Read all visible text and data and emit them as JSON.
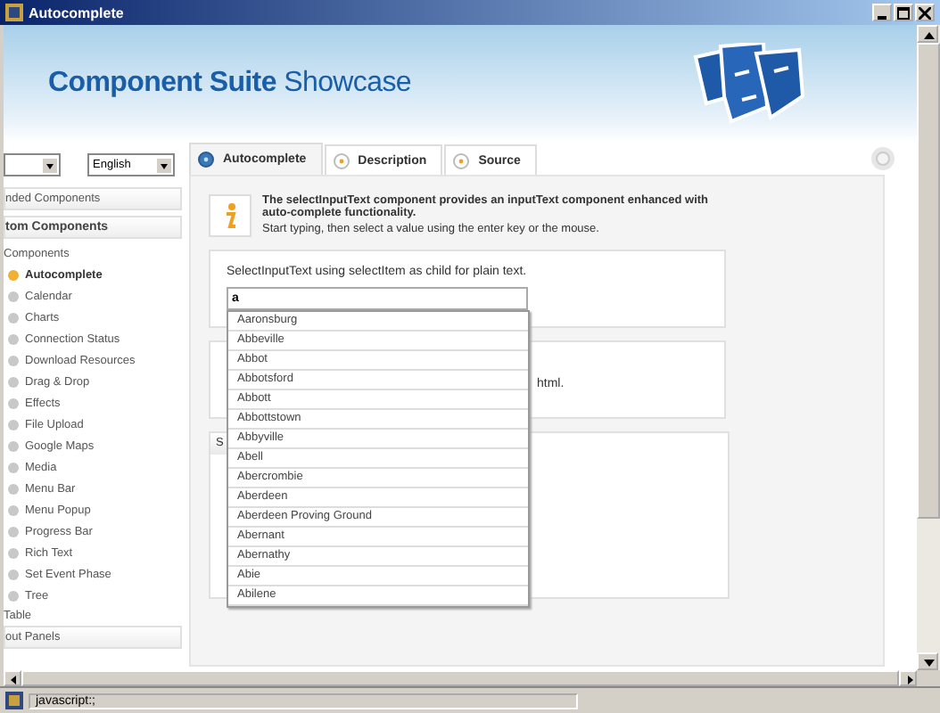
{
  "window": {
    "title": "Autocomplete"
  },
  "header": {
    "title_strong": "Component Suite",
    "title_light": "Showcase"
  },
  "sidebar": {
    "selects": [
      {
        "value": "English"
      }
    ],
    "panels": [
      {
        "label": "nded Components",
        "expanded": false
      },
      {
        "label": "tom Components",
        "expanded": true,
        "children": [
          {
            "label": "Components",
            "children": [
              {
                "label": "Autocomplete",
                "selected": true
              },
              {
                "label": "Calendar",
                "selected": false
              },
              {
                "label": "Charts",
                "selected": false
              },
              {
                "label": "Connection Status",
                "selected": false
              },
              {
                "label": "Download Resources",
                "selected": false
              },
              {
                "label": "Drag & Drop",
                "selected": false
              },
              {
                "label": "Effects",
                "selected": false
              },
              {
                "label": "File Upload",
                "selected": false
              },
              {
                "label": "Google Maps",
                "selected": false
              },
              {
                "label": "Media",
                "selected": false
              },
              {
                "label": "Menu Bar",
                "selected": false
              },
              {
                "label": "Menu Popup",
                "selected": false
              },
              {
                "label": "Progress Bar",
                "selected": false
              },
              {
                "label": "Rich Text",
                "selected": false
              },
              {
                "label": "Set Event Phase",
                "selected": false
              },
              {
                "label": "Tree",
                "selected": false
              }
            ]
          },
          {
            "label": "Table"
          }
        ]
      },
      {
        "label": "out Panels",
        "expanded": false
      }
    ]
  },
  "tabs": [
    {
      "label": "Autocomplete",
      "selected": true
    },
    {
      "label": "Description",
      "selected": false
    },
    {
      "label": "Source",
      "selected": false
    }
  ],
  "info": {
    "heading": "The selectInputText component provides an inputText component enhanced with auto-complete functionality.",
    "hint": "Start typing, then select a value using the enter key or the mouse."
  },
  "demo_1": {
    "label": "SelectInputText using selectItem as child for plain text.",
    "input_value": "a"
  },
  "demo_2": {
    "text": "html."
  },
  "demo_3": {
    "header": "S"
  },
  "dropdown": {
    "options": [
      "Aaronsburg",
      "Abbeville",
      "Abbot",
      "Abbotsford",
      "Abbott",
      "Abbottstown",
      "Abbyville",
      "Abell",
      "Abercrombie",
      "Aberdeen",
      "Aberdeen Proving Ground",
      "Abernant",
      "Abernathy",
      "Abie",
      "Abilene"
    ]
  },
  "status_bar": {
    "text": "javascript:;"
  }
}
